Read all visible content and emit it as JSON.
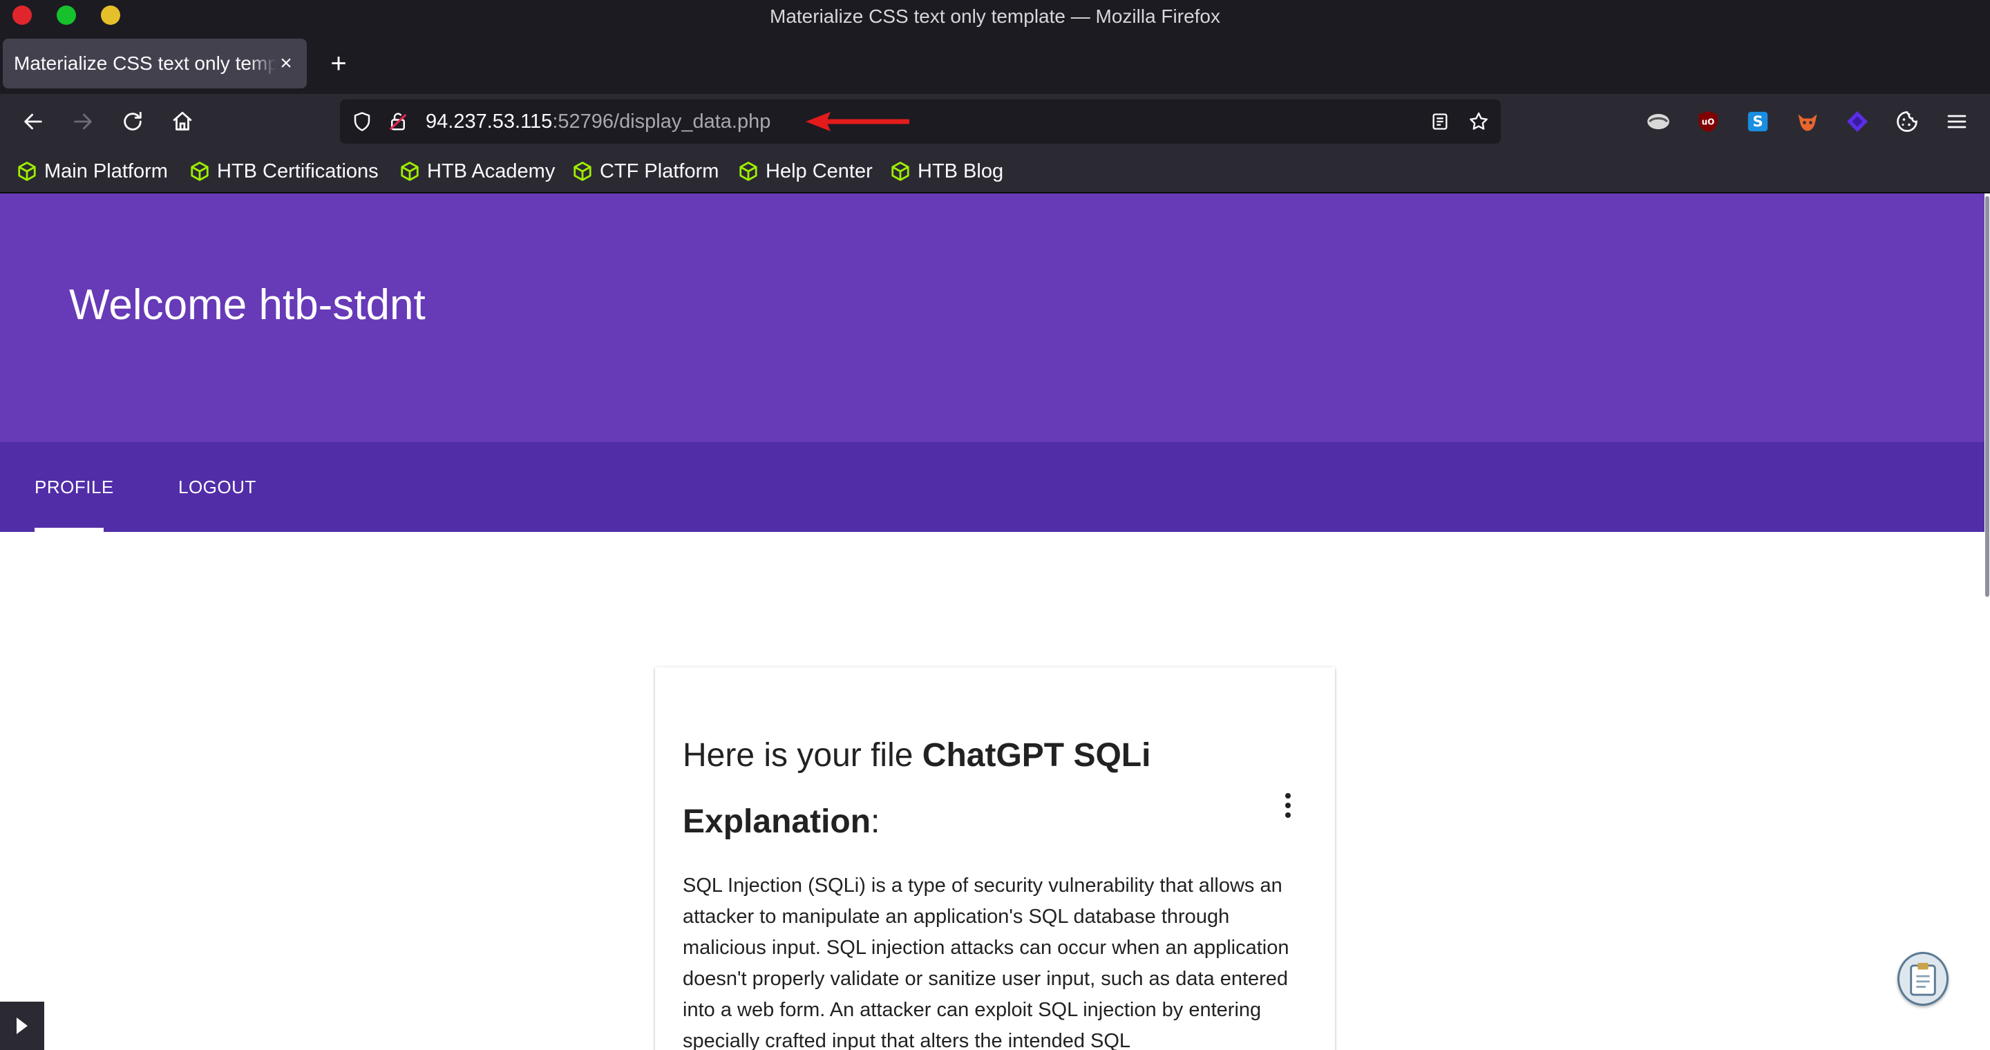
{
  "window": {
    "title": "Materialize CSS text only template — Mozilla Firefox"
  },
  "tabs": [
    {
      "title": "Materialize CSS text only template",
      "active": true
    }
  ],
  "url": {
    "host": "94.237.53.115",
    "rest": ":52796/display_data.php"
  },
  "bookmarks": [
    {
      "label": "Main Platform"
    },
    {
      "label": "HTB Certifications"
    },
    {
      "label": "HTB Academy"
    },
    {
      "label": "CTF Platform"
    },
    {
      "label": "Help Center"
    },
    {
      "label": "HTB Blog"
    }
  ],
  "page": {
    "welcome": "Welcome htb-stdnt",
    "nav": {
      "profile": "PROFILE",
      "logout": "LOGOUT"
    },
    "card": {
      "title_prefix": "Here is your file ",
      "title_bold": "ChatGPT SQLi Explanation",
      "title_suffix": ":",
      "body": "SQL Injection (SQLi) is a type of security vulnerability that allows an attacker to manipulate an application's SQL database through malicious input. SQL injection attacks can occur when an application doesn't properly validate or sanitize user input, such as data entered into a web form. An attacker can exploit SQL injection by entering specially crafted input that alters the intended SQL"
    }
  },
  "colors": {
    "header": "#673ab7",
    "tabs_bar": "#512da8",
    "arrow": "#e41b1b",
    "bookmark_icon": "#9fef00"
  }
}
